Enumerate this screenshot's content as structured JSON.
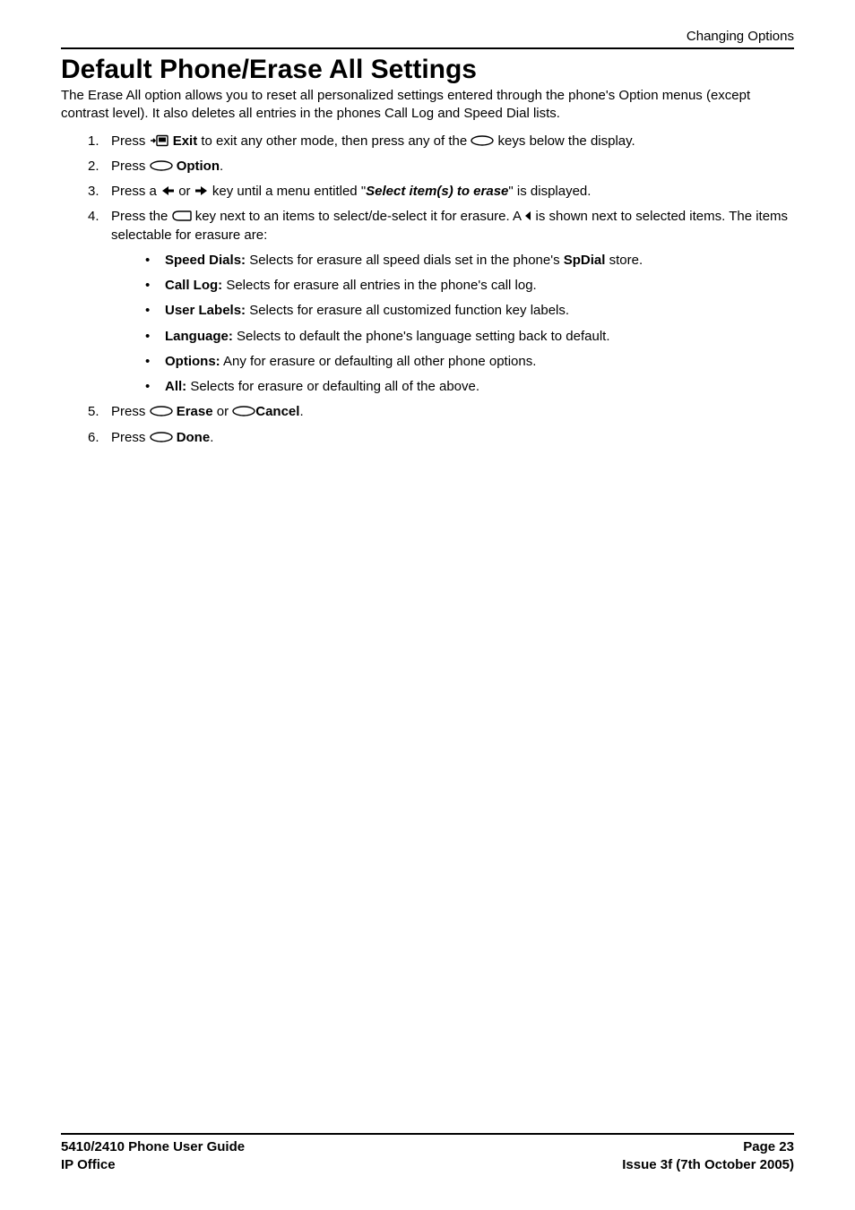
{
  "header": {
    "section_title": "Changing Options"
  },
  "title": "Default Phone/Erase All Settings",
  "intro": "The Erase All option allows you to reset all personalized settings entered through the phone's Option menus (except contrast level). It also deletes all entries in the phones Call Log and Speed Dial lists.",
  "steps": {
    "s1_num": "1.",
    "s1_a": "Press ",
    "s1_b_bold": "Exit",
    "s1_c": " to exit any other mode, then press any of the ",
    "s1_d": " keys below the display.",
    "s2_num": "2.",
    "s2_a": "Press ",
    "s2_b_bold": "Option",
    "s2_c": ".",
    "s3_num": "3.",
    "s3_a": "Press a ",
    "s3_b": " or ",
    "s3_c": " key until a menu entitled \"",
    "s3_d_bi": "Select item(s) to erase",
    "s3_e": "\" is displayed.",
    "s4_num": "4.",
    "s4_a": "Press the ",
    "s4_b": " key next to an items to select/de-select it for erasure. A ",
    "s4_c": " is shown next to selected items. The items selectable for erasure are:",
    "s5_num": "5.",
    "s5_a": "Press ",
    "s5_b_bold": "Erase",
    "s5_c": " or ",
    "s5_d_bold": "Cancel",
    "s5_e": ".",
    "s6_num": "6.",
    "s6_a": "Press ",
    "s6_b_bold": "Done",
    "s6_c": "."
  },
  "bullets": {
    "b1_label": "Speed Dials:",
    "b1_text": " Selects for erasure all speed dials set in the phone's ",
    "b1_bold2": "SpDial",
    "b1_after": " store.",
    "b2_label": "Call Log:",
    "b2_text": " Selects for erasure all entries in the phone's call log.",
    "b3_label": "User Labels:",
    "b3_text": " Selects for erasure all customized function key labels.",
    "b4_label": "Language:",
    "b4_text": " Selects to default the phone's language setting back to default.",
    "b5_label": "Options:",
    "b5_text": " Any for erasure or defaulting all other phone options.",
    "b6_label": "All:",
    "b6_text": " Selects for erasure or defaulting all of the above."
  },
  "footer": {
    "guide_title": "5410/2410 Phone User Guide",
    "product": "IP Office",
    "page": "Page 23",
    "issue": "Issue 3f (7th October 2005)"
  },
  "icons": {
    "exit": "exit-icon",
    "softkey": "softkey-icon",
    "softkey_right": "softkey-right-icon",
    "left_arrow": "left-arrow-icon",
    "right_arrow": "right-arrow-icon",
    "display_key": "display-key-icon",
    "triangle_left": "triangle-left-icon"
  }
}
